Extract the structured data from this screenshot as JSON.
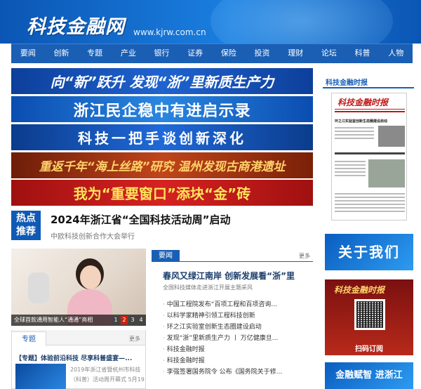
{
  "header": {
    "logo_text": "科技金融网",
    "url": "www.kjrw.com.cn"
  },
  "nav": [
    "要闻",
    "创新",
    "专题",
    "产业",
    "银行",
    "证券",
    "保险",
    "投资",
    "理财",
    "论坛",
    "科普",
    "人物"
  ],
  "banners": [
    "向“新”跃升 发现“浙”里新质生产力",
    "浙江民企稳中有进启示录",
    "科技一把手谈创新深化",
    "重返千年“海上丝路”研究 温州发现古商港遗址",
    "我为“重要窗口”添块“金”砖"
  ],
  "hot": {
    "badge_line1": "热点",
    "badge_line2": "推荐",
    "title": "2024年浙江省“全国科技活动周”启动",
    "subtitle": "中欧科技创新合作大会举行"
  },
  "slideshow": {
    "caption": "全球首款通用智能人“通通”亮相",
    "pages": [
      "1",
      "2",
      "3",
      "4"
    ]
  },
  "news": {
    "tab": "要闻",
    "more": "更多",
    "lead_title": "春风又绿江南岸 创新发展看“浙”里",
    "lead_sub": "全国科技媒体走进浙江开展主题采风",
    "items": [
      "中国工程院发布“百项工程和百项咨询...",
      "以科学家精神引领工程科技创新",
      "环之江实验室创新生态圈建设启动",
      "发现“浙”里新质生产力 丨 万亿健康旦...",
      "科技金融时报",
      "科技金融时报",
      "李强签署国务院令 公布《国务院关于修..."
    ]
  },
  "topics": {
    "tab": "专题",
    "more": "更多",
    "title": "【专题】体验前沿科技 尽享科普盛宴—...",
    "desc": "2019年浙江省暨杭州市科技（科普）活动周开幕式 5月19"
  },
  "sidebar": {
    "section_title": "科技金融时报",
    "paper_mast": "科技金融时报",
    "paper_headline": "环之江实验室创新生态圈建设启动",
    "about": "关于我们",
    "qr_mast": "科技金融时报",
    "qr_label": "扫码订阅",
    "bottom_banner": "金融赋智 进浙江"
  }
}
